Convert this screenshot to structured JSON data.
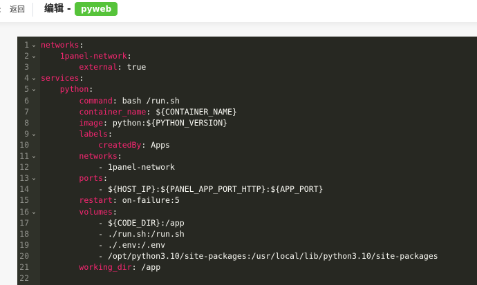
{
  "header": {
    "back_icon": "chevron-left-icon",
    "back_label": "返回",
    "title": "编辑 -",
    "app_name": "pyweb"
  },
  "colors": {
    "editor_bg": "#272822",
    "gutter_bg": "#2f3129",
    "key": "#f92672",
    "text": "#f8f8f2",
    "line_number": "#8f908a",
    "badge": "#56c33a"
  },
  "editor": {
    "fold_icon": "chevron-down-icon",
    "lines": [
      {
        "num": "1",
        "fold": true,
        "indent": "",
        "key": "networks",
        "value": ""
      },
      {
        "num": "2",
        "fold": true,
        "indent": "    ",
        "key": "1panel-network",
        "value": ""
      },
      {
        "num": "3",
        "fold": false,
        "indent": "        ",
        "key": "external",
        "value": " true"
      },
      {
        "num": "4",
        "fold": true,
        "indent": "",
        "key": "services",
        "value": ""
      },
      {
        "num": "5",
        "fold": true,
        "indent": "    ",
        "key": "python",
        "value": ""
      },
      {
        "num": "6",
        "fold": false,
        "indent": "        ",
        "key": "command",
        "value": " bash /run.sh"
      },
      {
        "num": "7",
        "fold": false,
        "indent": "        ",
        "key": "container_name",
        "value": " ${CONTAINER_NAME}"
      },
      {
        "num": "8",
        "fold": false,
        "indent": "        ",
        "key": "image",
        "value": " python:${PYTHON_VERSION}"
      },
      {
        "num": "9",
        "fold": true,
        "indent": "        ",
        "key": "labels",
        "value": ""
      },
      {
        "num": "10",
        "fold": false,
        "indent": "            ",
        "key": "createdBy",
        "value": " Apps"
      },
      {
        "num": "11",
        "fold": true,
        "indent": "        ",
        "key": "networks",
        "value": ""
      },
      {
        "num": "12",
        "fold": false,
        "indent": "            ",
        "key": "",
        "value": "- 1panel-network"
      },
      {
        "num": "13",
        "fold": true,
        "indent": "        ",
        "key": "ports",
        "value": ""
      },
      {
        "num": "14",
        "fold": false,
        "indent": "            ",
        "key": "",
        "value": "- ${HOST_IP}:${PANEL_APP_PORT_HTTP}:${APP_PORT}"
      },
      {
        "num": "15",
        "fold": false,
        "indent": "        ",
        "key": "restart",
        "value": " on-failure:5"
      },
      {
        "num": "16",
        "fold": true,
        "indent": "        ",
        "key": "volumes",
        "value": ""
      },
      {
        "num": "17",
        "fold": false,
        "indent": "            ",
        "key": "",
        "value": "- ${CODE_DIR}:/app"
      },
      {
        "num": "18",
        "fold": false,
        "indent": "            ",
        "key": "",
        "value": "- ./run.sh:/run.sh"
      },
      {
        "num": "19",
        "fold": false,
        "indent": "            ",
        "key": "",
        "value": "- ./.env:/.env"
      },
      {
        "num": "20",
        "fold": false,
        "indent": "            ",
        "key": "",
        "value": "- /opt/python3.10/site-packages:/usr/local/lib/python3.10/site-packages"
      },
      {
        "num": "21",
        "fold": false,
        "indent": "        ",
        "key": "working_dir",
        "value": " /app"
      },
      {
        "num": "22",
        "fold": false,
        "indent": "",
        "key": "",
        "value": ""
      }
    ]
  }
}
